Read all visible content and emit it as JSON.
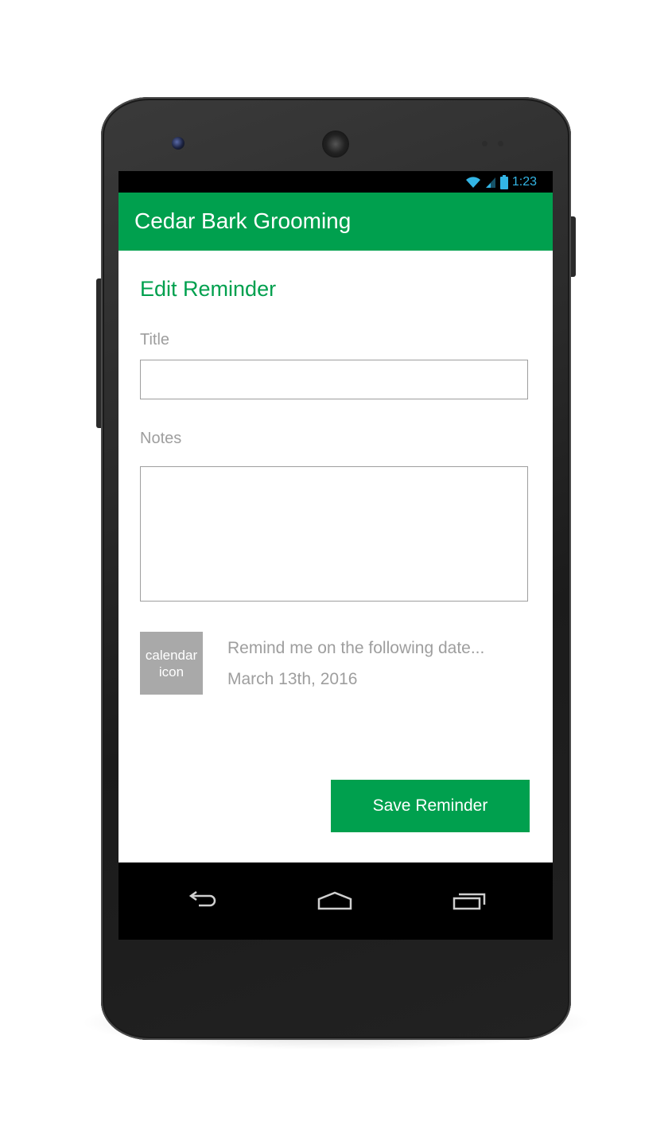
{
  "status_bar": {
    "time": "1:23",
    "icons": [
      "wifi-icon",
      "signal-icon",
      "battery-icon"
    ],
    "accent_color": "#33b5e5"
  },
  "app_bar": {
    "title": "Cedar Bark Grooming",
    "color": "#00a04e"
  },
  "form": {
    "heading": "Edit Reminder",
    "title_label": "Title",
    "title_value": "",
    "notes_label": "Notes",
    "notes_value": "",
    "calendar_icon_text_line1": "calendar",
    "calendar_icon_text_line2": "icon",
    "remind_prompt": "Remind me on the following date...",
    "remind_date": "March 13th, 2016",
    "save_label": "Save Reminder"
  },
  "nav_bar": {
    "icons": [
      "back-icon",
      "home-icon",
      "recents-icon"
    ]
  }
}
